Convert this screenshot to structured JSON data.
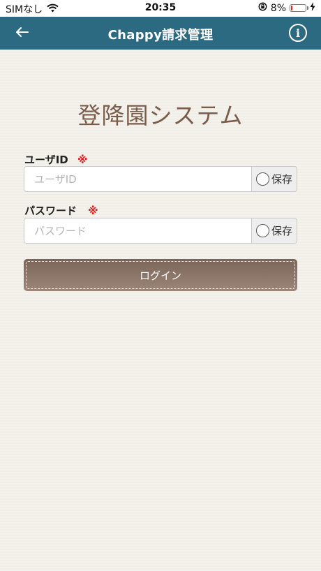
{
  "status_bar": {
    "carrier": "SIMなし",
    "time": "20:35",
    "battery_percent": "8%",
    "battery_level": 0.08,
    "battery_color": "#e0241c"
  },
  "nav": {
    "title": "Chappy請求管理",
    "back_icon": "arrow-left-icon",
    "info_icon": "info-icon",
    "info_glyph": "i",
    "bar_color": "#2b6a80"
  },
  "main": {
    "system_title": "登降園システム",
    "user_id": {
      "label": "ユーザID",
      "required_mark": "※",
      "placeholder": "ユーザID",
      "value": "",
      "save_label": "保存"
    },
    "password": {
      "label": "パスワード",
      "required_mark": "※",
      "placeholder": "パスワード",
      "value": "",
      "save_label": "保存"
    },
    "login_button": "ログイン",
    "accent_color": "#7a5c4a"
  }
}
